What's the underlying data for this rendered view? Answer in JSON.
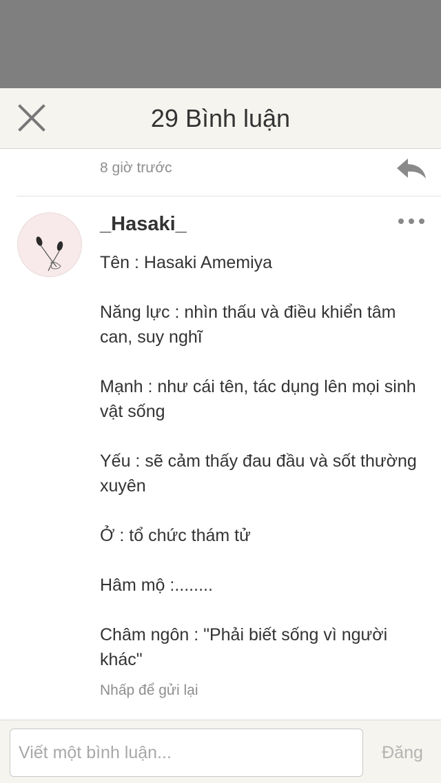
{
  "header": {
    "title": "29 Bình luận",
    "close_icon": "close-icon"
  },
  "previous_comment": {
    "time": "8 giờ trước",
    "reply_icon": "reply-icon"
  },
  "comment": {
    "author": "_Hasaki_",
    "avatar_icon": "earphones-avatar",
    "more_icon": "more-dots-icon",
    "paragraphs": [
      "Tên : Hasaki Amemiya",
      "Năng lực : nhìn thấu và điều khiển tâm can, suy nghĩ",
      "Mạnh : như cái tên, tác dụng lên mọi sinh vật sống",
      "Yếu : sẽ cảm thấy đau đầu và sốt thường xuyên",
      "Ở : tổ chức thám tử",
      "Hâm mộ :........",
      "Châm ngôn : \"Phải biết sống vì người khác\""
    ],
    "retry_label": "Nhấp để gửi lại"
  },
  "composer": {
    "placeholder": "Viết một bình luận...",
    "value": "",
    "post_label": "Đăng"
  },
  "colors": {
    "overlay": "#7f7f7f",
    "header_bg": "#f5f4ee",
    "muted_text": "#8e8e8e",
    "icon_gray": "#888888"
  }
}
